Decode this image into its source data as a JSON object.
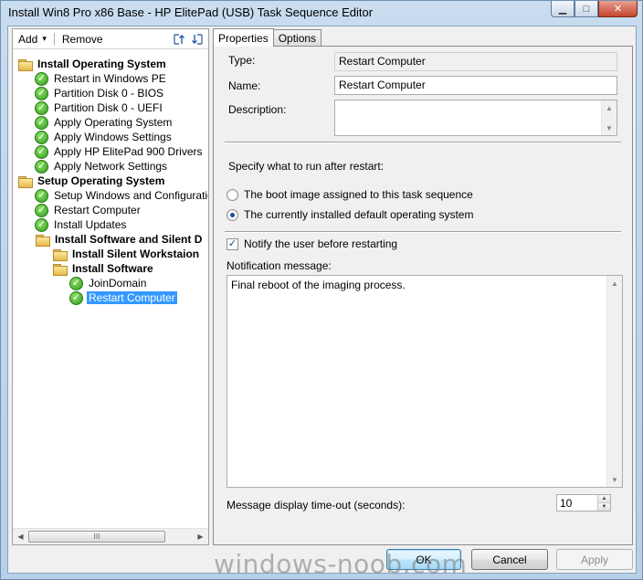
{
  "window": {
    "title": "Install Win8 Pro x86 Base - HP ElitePad (USB) Task Sequence Editor",
    "minimize_glyph": "▁",
    "maximize_glyph": "□",
    "close_glyph": "✕"
  },
  "toolbar": {
    "add_label": "Add",
    "add_arrow": "▾",
    "remove_label": "Remove",
    "icons": [
      "move-up-icon",
      "move-down-icon"
    ]
  },
  "tree": {
    "items": [
      {
        "label": "Install Operating System",
        "icon": "folder",
        "bold": true,
        "indent": 0
      },
      {
        "label": "Restart in Windows PE",
        "icon": "check",
        "bold": false,
        "indent": 1
      },
      {
        "label": "Partition Disk 0 - BIOS",
        "icon": "check",
        "bold": false,
        "indent": 1
      },
      {
        "label": "Partition Disk 0 - UEFI",
        "icon": "check",
        "bold": false,
        "indent": 1
      },
      {
        "label": "Apply Operating System",
        "icon": "check",
        "bold": false,
        "indent": 1
      },
      {
        "label": "Apply Windows Settings",
        "icon": "check",
        "bold": false,
        "indent": 1
      },
      {
        "label": "Apply HP ElitePad 900 Drivers",
        "icon": "check",
        "bold": false,
        "indent": 1
      },
      {
        "label": "Apply Network Settings",
        "icon": "check",
        "bold": false,
        "indent": 1
      },
      {
        "label": "Setup Operating System",
        "icon": "folder",
        "bold": true,
        "indent": 0
      },
      {
        "label": "Setup Windows and Configuration",
        "icon": "check",
        "bold": false,
        "indent": 1
      },
      {
        "label": "Restart Computer",
        "icon": "check",
        "bold": false,
        "indent": 1
      },
      {
        "label": "Install Updates",
        "icon": "check",
        "bold": false,
        "indent": 1
      },
      {
        "label": "Install Software and Silent D",
        "icon": "folder",
        "bold": true,
        "indent": 1
      },
      {
        "label": "Install Silent Workstaion",
        "icon": "folder",
        "bold": true,
        "indent": 2
      },
      {
        "label": "Install Software",
        "icon": "folder",
        "bold": true,
        "indent": 2
      },
      {
        "label": "JoinDomain",
        "icon": "check",
        "bold": false,
        "indent": 3
      },
      {
        "label": "Restart Computer",
        "icon": "check",
        "bold": false,
        "indent": 3,
        "selected": true
      }
    ],
    "hscroll_grip": "III"
  },
  "tabs": [
    {
      "label": "Properties",
      "active": true
    },
    {
      "label": "Options",
      "active": false
    }
  ],
  "properties": {
    "type_label": "Type:",
    "type_value": "Restart Computer",
    "name_label": "Name:",
    "name_value": "Restart Computer",
    "description_label": "Description:",
    "description_value": "",
    "after_restart_label": "Specify what to run after restart:",
    "radio_boot_image": "The boot image assigned to this task sequence",
    "radio_default_os": "The currently installed default operating system",
    "selected_radio": "default_os",
    "notify_label": "Notify the user before restarting",
    "notify_checked": true,
    "notification_label": "Notification message:",
    "notification_value": "Final reboot of the imaging process.",
    "timeout_label": "Message display time-out (seconds):",
    "timeout_value": "10"
  },
  "buttons": {
    "ok": "OK",
    "cancel": "Cancel",
    "apply": "Apply"
  },
  "watermark": "windows-noob.com",
  "colors": {
    "selection": "#3399ff",
    "check_green": "#2e9a1b",
    "folder_yellow": "#e3b94c"
  }
}
